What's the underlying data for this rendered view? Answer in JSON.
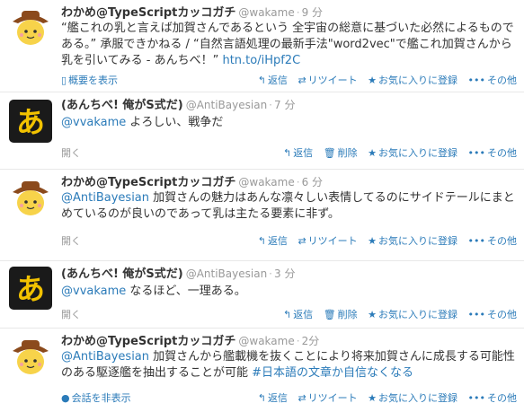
{
  "icons": {
    "reply": "reply-icon",
    "retweet": "retweet-icon",
    "delete": "trash-icon",
    "favorite": "star-icon",
    "more": "more-icon",
    "details": "details-icon",
    "conversation": "conversation-icon"
  },
  "colors": {
    "link": "#2b7bb9",
    "muted": "#999999",
    "name": "#333333",
    "divider": "#e8e8e8",
    "avatar_bg_black": "#1a1a1a",
    "avatar_glyph": "#f2c200"
  },
  "tweets": [
    {
      "name": "わかめ@TypeScriptカッコガチ",
      "handle": "@wakame",
      "time": "9 分",
      "lines": [
        "“艦これの乳と言えば加賀さんであるという 全宇宙の総意に基づいた必然によるものである。” 承服できかねる / “自然言語処理の最新手法\"word2vec\"で艦これ加賀さんから乳を引いてみる - あんちべ！”"
      ],
      "link": "htn.to/iHpf2C",
      "footer_left": "概要を表示",
      "actions": [
        "返信",
        "リツイート",
        "お気に入りに登録",
        "その他"
      ]
    },
    {
      "name": "(あんちべ! 俺がS式だ)",
      "handle": "@AntiBayesian",
      "time": "7 分",
      "mention": "@vvakame",
      "text": " よろしい、戦争だ",
      "footer_left": "開く",
      "actions": [
        "返信",
        "削除",
        "お気に入りに登録",
        "その他"
      ]
    },
    {
      "name": "わかめ@TypeScriptカッコガチ",
      "handle": "@wakame",
      "time": "6 分",
      "mention": "@AntiBayesian",
      "text": " 加賀さんの魅力はあんな凛々しい表情してるのにサイドテールにまとめているのが良いのであって乳は主たる要素に非ず。",
      "footer_left": "開く",
      "actions": [
        "返信",
        "リツイート",
        "お気に入りに登録",
        "その他"
      ]
    },
    {
      "name": "(あんちべ! 俺がS式だ)",
      "handle": "@AntiBayesian",
      "time": "3 分",
      "mention": "@vvakame",
      "text": " なるほど、一理ある。",
      "footer_left": "開く",
      "actions": [
        "返信",
        "削除",
        "お気に入りに登録",
        "その他"
      ]
    },
    {
      "name": "わかめ@TypeScriptカッコガチ",
      "handle": "@wakame",
      "time": "2分",
      "mention": "@AntiBayesian",
      "text": " 加賀さんから艦載機を抜くことにより将来加賀さんに成長する可能性のある駆逐艦を抽出することが可能 ",
      "hashtag": "#日本語の文章か自信なくなる",
      "footer_left": "会話を非表示",
      "actions": [
        "返信",
        "リツイート",
        "お気に入りに登録",
        "その他"
      ]
    }
  ],
  "avatar_glyph": "あ"
}
